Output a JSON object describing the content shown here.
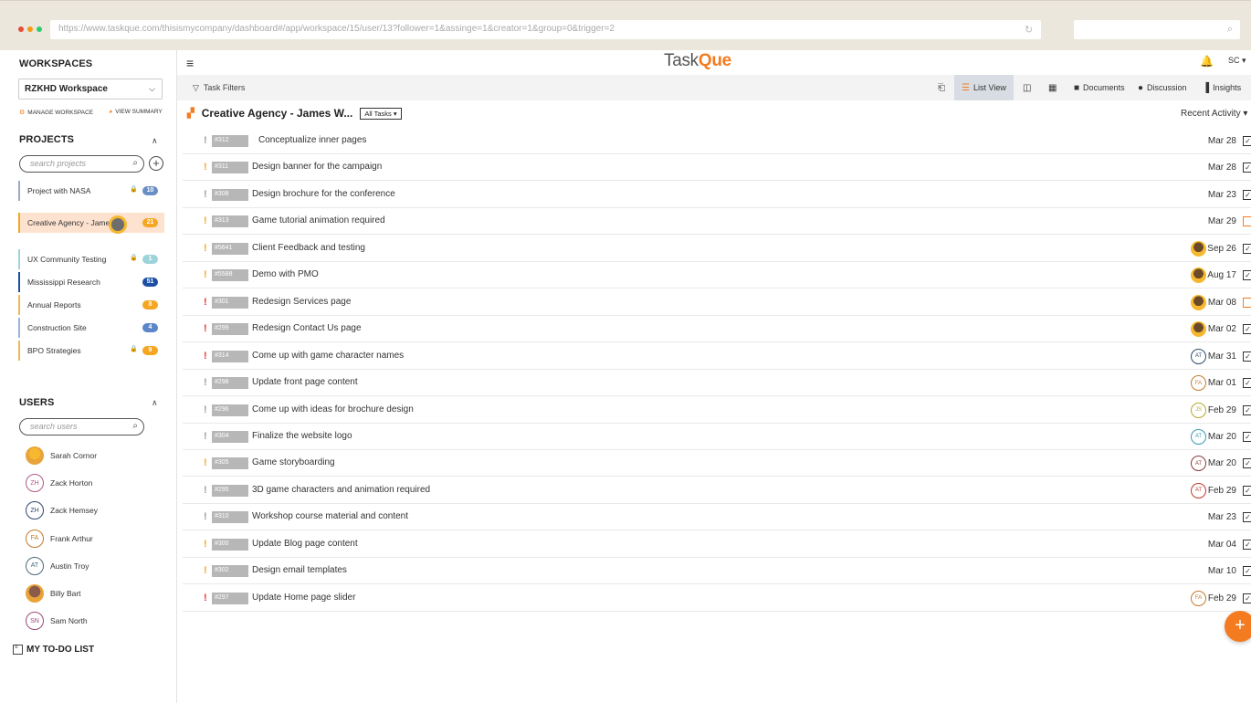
{
  "browser": {
    "url": "https://www.taskque.com/thisismycompany/dashboard#/app/workspace/15/user/13?follower=1&assinge=1&creator=1&group=0&trigger=2"
  },
  "sidebar": {
    "workspaces_title": "WORKSPACES",
    "workspace_selected": "RZKHD Workspace",
    "manage_workspace": "MANAGE WORKSPACE",
    "view_summary": "VIEW SUMMARY",
    "projects_title": "PROJECTS",
    "projects_search_placeholder": "search projects",
    "projects": [
      {
        "name": "Project with NASA",
        "locked": true,
        "count": "10",
        "color": "#6a8fc4",
        "bar": "#9aa9c8"
      },
      {
        "name": "Creative Agency - Jame",
        "locked": false,
        "count": "21",
        "color": "#f5a623",
        "bar": "#f5a623"
      },
      {
        "name": "UX Community Testing",
        "locked": true,
        "count": "1",
        "color": "#9fd3dc",
        "bar": "#9fd3dc"
      },
      {
        "name": "Mississippi Research",
        "locked": false,
        "count": "51",
        "color": "#1c4fa3",
        "bar": "#1c4fa3"
      },
      {
        "name": "Annual Reports",
        "locked": false,
        "count": "8",
        "color": "#f5a623",
        "bar": "#f5b65a"
      },
      {
        "name": "Construction Site",
        "locked": false,
        "count": "4",
        "color": "#5b86c9",
        "bar": "#9ab5d9"
      },
      {
        "name": "BPO Strategies",
        "locked": true,
        "count": "9",
        "color": "#f5a623",
        "bar": "#f5b65a"
      }
    ],
    "users_title": "USERS",
    "users_search_placeholder": "search users",
    "users": [
      {
        "name": "Sarah Cornor",
        "initials": "",
        "color": "#f5b82e",
        "photo": true
      },
      {
        "name": "Zack Horton",
        "initials": "ZH",
        "color": "#b05a8a",
        "photo": false
      },
      {
        "name": "Zack Hemsey",
        "initials": "ZH",
        "color": "#2c4a6e",
        "photo": false
      },
      {
        "name": "Frank Arthur",
        "initials": "FA",
        "color": "#c47a2c",
        "photo": false
      },
      {
        "name": "Austin Troy",
        "initials": "AT",
        "color": "#4a6a7a",
        "photo": false
      },
      {
        "name": "Billy Bart",
        "initials": "",
        "color": "#8a5a4a",
        "photo": true
      },
      {
        "name": "Sam North",
        "initials": "SN",
        "color": "#9a4a7a",
        "photo": false
      }
    ],
    "todo_label": "MY TO-DO LIST"
  },
  "header": {
    "logo_prefix": "Task",
    "logo_accent": "Que",
    "user_initials": "SC"
  },
  "toolbar": {
    "task_filters": "Task Filters",
    "list_view": "List View",
    "documents": "Documents",
    "discussion": "Discussion",
    "insights": "Insights"
  },
  "project": {
    "title": "Creative Agency - James W...",
    "filter": "All Tasks",
    "sort": "Recent Activity"
  },
  "colors": {
    "accent": "#f47b20",
    "high": "#e53935",
    "medium": "#f5a623",
    "low": "#9e9e9e"
  },
  "tasks": [
    {
      "id": "#312",
      "name": "Conceptualize inner pages",
      "priority": "low",
      "date": "Mar 28",
      "done": true,
      "avatar": ""
    },
    {
      "id": "#311",
      "name": "Design banner for the campaign",
      "priority": "medium",
      "date": "Mar 28",
      "done": true,
      "avatar": ""
    },
    {
      "id": "#308",
      "name": "Design brochure for the conference",
      "priority": "low",
      "date": "Mar 23",
      "done": true,
      "avatar": ""
    },
    {
      "id": "#313",
      "name": "Game tutorial animation required",
      "priority": "medium",
      "date": "Mar 29",
      "done": false,
      "avatar": ""
    },
    {
      "id": "#5641",
      "name": "Client Feedback and testing",
      "priority": "medium",
      "date": "Sep 26",
      "done": true,
      "avatar": "photo"
    },
    {
      "id": "#5588",
      "name": "Demo with PMO",
      "priority": "medium",
      "date": "Aug 17",
      "done": true,
      "avatar": "photo"
    },
    {
      "id": "#301",
      "name": "Redesign Services page",
      "priority": "high",
      "date": "Mar 08",
      "done": false,
      "avatar": "photo"
    },
    {
      "id": "#299",
      "name": "Redesign Contact Us page",
      "priority": "high",
      "date": "Mar 02",
      "done": true,
      "avatar": "photo"
    },
    {
      "id": "#314",
      "name": "Come up with game character names",
      "priority": "high",
      "date": "Mar 31",
      "done": true,
      "avatar": "AT",
      "avatar_color": "#2c4a6e"
    },
    {
      "id": "#298",
      "name": "Update front page content",
      "priority": "low",
      "date": "Mar 01",
      "done": true,
      "avatar": "FA",
      "avatar_color": "#c47a2c"
    },
    {
      "id": "#296",
      "name": "Come up with ideas for brochure design",
      "priority": "low",
      "date": "Feb 29",
      "done": true,
      "avatar": "JS",
      "avatar_color": "#b5a82c"
    },
    {
      "id": "#304",
      "name": "Finalize the website logo",
      "priority": "low",
      "date": "Mar 20",
      "done": true,
      "avatar": "AT",
      "avatar_color": "#3a9ab0"
    },
    {
      "id": "#305",
      "name": "Game storyboarding",
      "priority": "medium",
      "date": "Mar 20",
      "done": true,
      "avatar": "AT",
      "avatar_color": "#8a3a3a"
    },
    {
      "id": "#295",
      "name": "3D game characters and animation required",
      "priority": "low",
      "date": "Feb 29",
      "done": true,
      "avatar": "AT",
      "avatar_color": "#c0392b"
    },
    {
      "id": "#310",
      "name": "Workshop course material and content",
      "priority": "low",
      "date": "Mar 23",
      "done": true,
      "avatar": ""
    },
    {
      "id": "#300",
      "name": "Update Blog page content",
      "priority": "medium",
      "date": "Mar 04",
      "done": true,
      "avatar": ""
    },
    {
      "id": "#302",
      "name": "Design email templates",
      "priority": "medium",
      "date": "Mar 10",
      "done": true,
      "avatar": ""
    },
    {
      "id": "#297",
      "name": "Update Home page slider",
      "priority": "high",
      "date": "Feb 29",
      "done": true,
      "avatar": "FA",
      "avatar_color": "#c47a2c"
    }
  ]
}
